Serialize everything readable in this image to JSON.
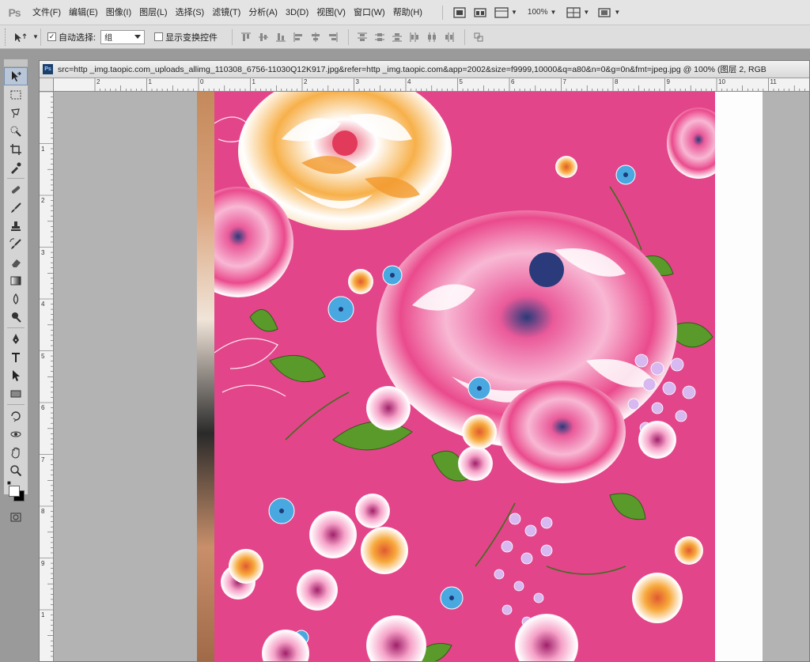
{
  "app": {
    "logo": "Ps"
  },
  "menu": {
    "items": [
      "文件(F)",
      "编辑(E)",
      "图像(I)",
      "图层(L)",
      "选择(S)",
      "滤镜(T)",
      "分析(A)",
      "3D(D)",
      "视图(V)",
      "窗口(W)",
      "帮助(H)"
    ],
    "zoom": "100%"
  },
  "options": {
    "auto_select_label": "自动选择:",
    "auto_select_checked": "✓",
    "auto_select_value": "组",
    "show_transform_label": "显示变换控件"
  },
  "document": {
    "title": "src=http _img.taopic.com_uploads_allimg_110308_6756-11030Q12K917.jpg&refer=http _img.taopic.com&app=2002&size=f9999,10000&q=a80&n=0&g=0n&fmt=jpeg.jpg @ 100% (图层 2, RGB",
    "ruler_h_labels": [
      "2",
      "1",
      "0",
      "1",
      "2",
      "3",
      "4",
      "5",
      "6",
      "7",
      "8",
      "9",
      "10",
      "11"
    ],
    "ruler_v_labels": [
      "1",
      "2",
      "3",
      "4",
      "5",
      "6",
      "7",
      "8",
      "9",
      "1",
      "1"
    ]
  },
  "colors": {
    "pattern_pink": "#e2458a",
    "peony_orange": "#f4a23a",
    "peony_pink": "#ea5a9a",
    "leaf_green": "#5a9a2a",
    "flower_blue": "#4aa8e0"
  }
}
